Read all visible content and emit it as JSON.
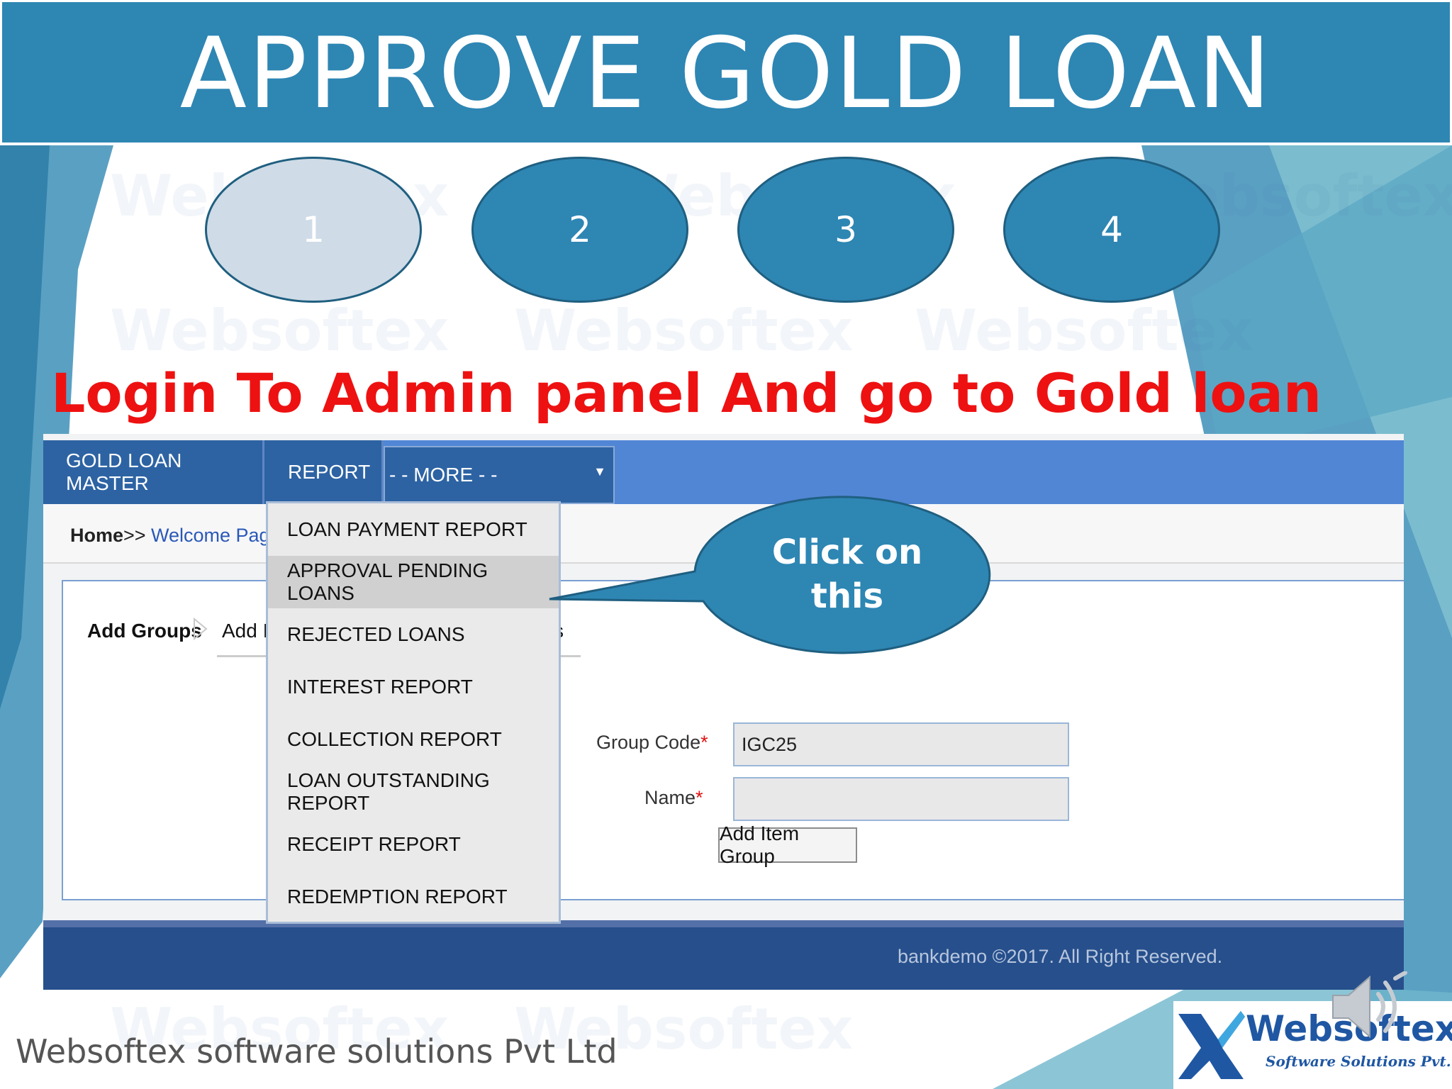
{
  "slide": {
    "title": "APPROVE GOLD LOAN",
    "steps": [
      "1",
      "2",
      "3",
      "4"
    ],
    "active_step": 1,
    "instruction": "Login To Admin panel And go to Gold loan",
    "callout": {
      "line1": "Click on",
      "line2": "this"
    },
    "company": "Websoftex software solutions Pvt Ltd",
    "watermark": "Websoftex",
    "logo": {
      "word": "Websoftex",
      "subtitle": "Software Solutions Pvt. Ltd."
    },
    "audio_icon": "speaker-icon"
  },
  "app": {
    "nav": {
      "gold_loan_master": "GOLD LOAN MASTER",
      "report": "REPORT",
      "more": "- - MORE - -"
    },
    "report_menu": [
      "LOAN PAYMENT REPORT",
      "APPROVAL PENDING LOANS",
      "REJECTED LOANS",
      "INTEREST REPORT",
      "COLLECTION REPORT",
      "LOAN OUTSTANDING REPORT",
      "RECEIPT REPORT",
      "REDEMPTION REPORT"
    ],
    "highlighted_menu_item": "APPROVAL PENDING LOANS",
    "breadcrumb": {
      "home": "Home",
      "separator": ">>",
      "page": "Welcome Page"
    },
    "tabs": {
      "add_groups": "Add Groups",
      "add_item_partial": "Add I",
      "tail_partial": "s"
    },
    "form": {
      "group_code_label": "Group Code",
      "group_code_value": "IGC25",
      "name_label": "Name",
      "name_value": "",
      "required_mark": "*",
      "submit_label": "Add Item Group"
    },
    "footer": "bankdemo ©2017. All Right Reserved."
  },
  "colors": {
    "title_band": "#2e86b3",
    "instruction": "#ee1111",
    "nav_bar": "#5186d5",
    "nav_item": "#2d63a3",
    "footer": "#264f8c"
  }
}
